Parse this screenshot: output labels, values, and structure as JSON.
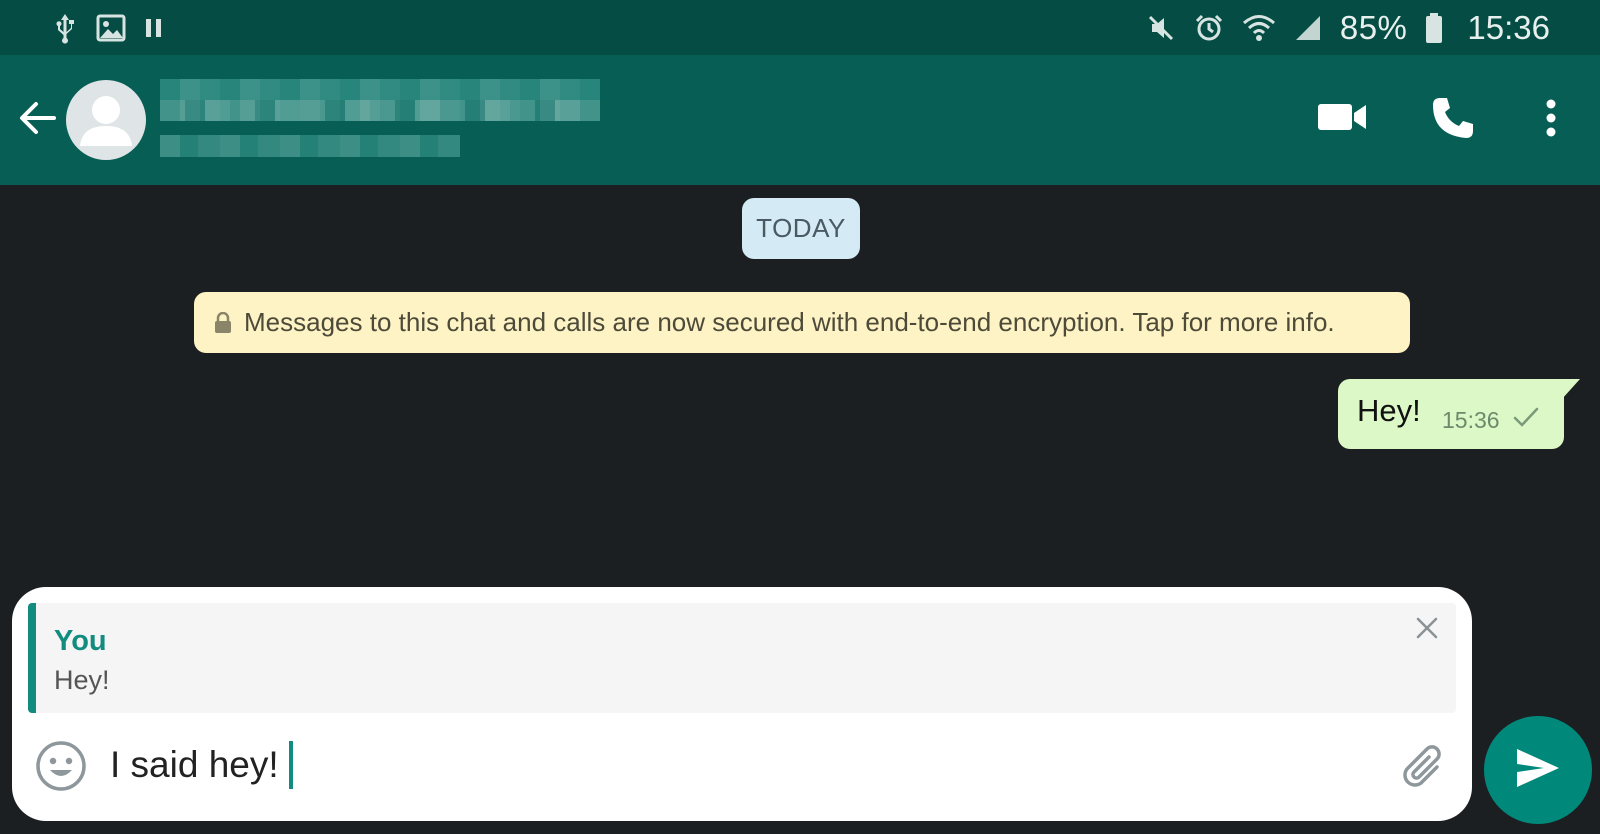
{
  "status_bar": {
    "battery_percent": "85%",
    "time": "15:36",
    "left_icons": [
      "usb-icon",
      "image-icon",
      "pause-icon"
    ],
    "right_icons": [
      "mute-icon",
      "alarm-icon",
      "wifi-icon",
      "signal-icon",
      "battery-icon"
    ]
  },
  "header": {
    "contact_name": "",
    "contact_status": "",
    "icons": [
      "back-arrow-icon",
      "avatar-icon",
      "video-call-icon",
      "phone-icon",
      "more-vert-icon"
    ]
  },
  "chat": {
    "date_chip": "TODAY",
    "encryption_notice": "Messages to this chat and calls are now secured with end-to-end encryption. Tap for more info.",
    "messages": [
      {
        "direction": "outgoing",
        "text": "Hey!",
        "time": "15:36",
        "status": "sent"
      }
    ]
  },
  "composer": {
    "reply": {
      "author": "You",
      "text": "Hey!"
    },
    "input_value": "I said hey!",
    "icons": [
      "emoji-icon",
      "attach-icon",
      "close-icon"
    ]
  },
  "colors": {
    "status_bar": "#054d44",
    "header": "#075e54",
    "chat_background": "#1b1f22",
    "outgoing_bubble": "#dcf8c6",
    "date_chip": "#d4eaf4",
    "encryption_notice": "#fdf3c4",
    "accent": "#128c7e",
    "send_button": "#00897b"
  }
}
